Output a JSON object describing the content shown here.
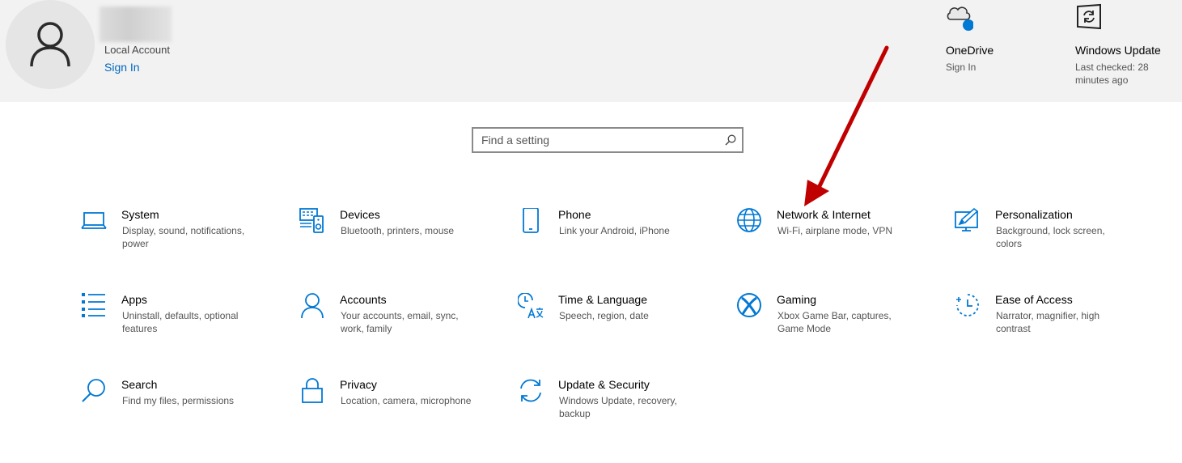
{
  "account": {
    "type": "Local Account",
    "sign_in": "Sign In"
  },
  "onedrive": {
    "title": "OneDrive",
    "subtitle": "Sign In",
    "icon": "cloud-icon"
  },
  "windows_update": {
    "title": "Windows Update",
    "subtitle": "Last checked: 28 minutes ago",
    "icon": "update-icon"
  },
  "search": {
    "placeholder": "Find a setting",
    "value": ""
  },
  "categories": [
    {
      "title": "System",
      "desc": "Display, sound, notifications, power",
      "icon": "laptop-icon"
    },
    {
      "title": "Devices",
      "desc": "Bluetooth, printers, mouse",
      "icon": "devices-icon"
    },
    {
      "title": "Phone",
      "desc": "Link your Android, iPhone",
      "icon": "phone-icon"
    },
    {
      "title": "Network & Internet",
      "desc": "Wi-Fi, airplane mode, VPN",
      "icon": "globe-icon"
    },
    {
      "title": "Personalization",
      "desc": "Background, lock screen, colors",
      "icon": "personalization-icon"
    },
    {
      "title": "Apps",
      "desc": "Uninstall, defaults, optional features",
      "icon": "apps-list-icon"
    },
    {
      "title": "Accounts",
      "desc": "Your accounts, email, sync, work, family",
      "icon": "person-icon"
    },
    {
      "title": "Time & Language",
      "desc": "Speech, region, date",
      "icon": "time-language-icon"
    },
    {
      "title": "Gaming",
      "desc": "Xbox Game Bar, captures, Game Mode",
      "icon": "xbox-icon"
    },
    {
      "title": "Ease of Access",
      "desc": "Narrator, magnifier, high contrast",
      "icon": "ease-of-access-icon"
    },
    {
      "title": "Search",
      "desc": "Find my files, permissions",
      "icon": "search-icon"
    },
    {
      "title": "Privacy",
      "desc": "Location, camera, microphone",
      "icon": "lock-icon"
    },
    {
      "title": "Update & Security",
      "desc": "Windows Update, recovery, backup",
      "icon": "sync-icon"
    }
  ],
  "colors": {
    "accent": "#0067c0",
    "icon_blue": "#0078d4",
    "annotation_arrow": "#c00000",
    "header_bg": "#f2f2f2"
  }
}
